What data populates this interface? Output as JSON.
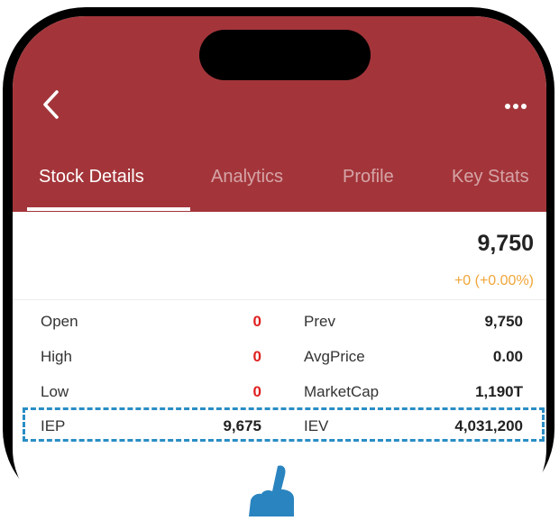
{
  "header": {
    "back_icon": "chevron-left-icon",
    "more_icon": "ellipsis-icon",
    "color": "#a3353a"
  },
  "tabs": [
    {
      "label": "Stock Details",
      "active": true
    },
    {
      "label": "Analytics",
      "active": false
    },
    {
      "label": "Profile",
      "active": false
    },
    {
      "label": "Key Stats",
      "active": false
    }
  ],
  "quote": {
    "price": "9,750",
    "change": "+0 (+0.00%)",
    "change_color": "#f0a63a"
  },
  "stats": [
    {
      "left_label": "Open",
      "left_value": "0",
      "right_label": "Prev",
      "right_value": "9,750"
    },
    {
      "left_label": "High",
      "left_value": "0",
      "right_label": "AvgPrice",
      "right_value": "0.00"
    },
    {
      "left_label": "Low",
      "left_value": "0",
      "right_label": "MarketCap",
      "right_value": "1,190T"
    },
    {
      "left_label": "IEP",
      "left_value": "9,675",
      "right_label": "IEV",
      "right_value": "4,031,200"
    }
  ],
  "colors": {
    "negative": "#e02020",
    "highlight_border": "#2a8dc5"
  }
}
